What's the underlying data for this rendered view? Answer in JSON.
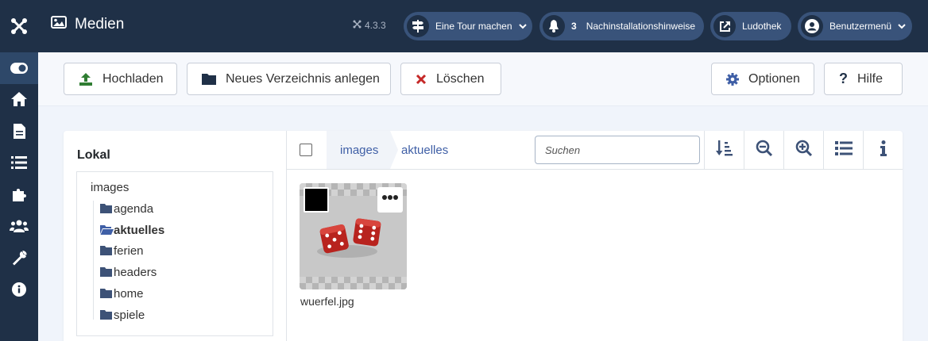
{
  "header": {
    "title": "Medien",
    "version": "4.3.3",
    "tour_label": "Eine Tour machen",
    "notifications_count": "3",
    "post_install_label": "Nachinstallationshinweise",
    "site_label": "Ludothek",
    "user_menu_label": "Benutzermenü"
  },
  "toolbar": {
    "upload_label": "Hochladen",
    "new_folder_label": "Neues Verzeichnis anlegen",
    "delete_label": "Löschen",
    "options_label": "Optionen",
    "help_label": "Hilfe"
  },
  "tree": {
    "title": "Lokal",
    "root": "images",
    "items": [
      {
        "label": "agenda"
      },
      {
        "label": "aktuelles"
      },
      {
        "label": "ferien"
      },
      {
        "label": "headers"
      },
      {
        "label": "home"
      },
      {
        "label": "spiele"
      }
    ]
  },
  "browser": {
    "breadcrumbs": [
      "images",
      "aktuelles"
    ],
    "search_placeholder": "Suchen"
  },
  "files": [
    {
      "name": "wuerfel.jpg"
    }
  ],
  "colors": {
    "sidebar": "#1f3047",
    "pill": "#39537a",
    "accent": "#3f5fa6",
    "delete": "#c52827",
    "upload": "#2f7d32"
  }
}
